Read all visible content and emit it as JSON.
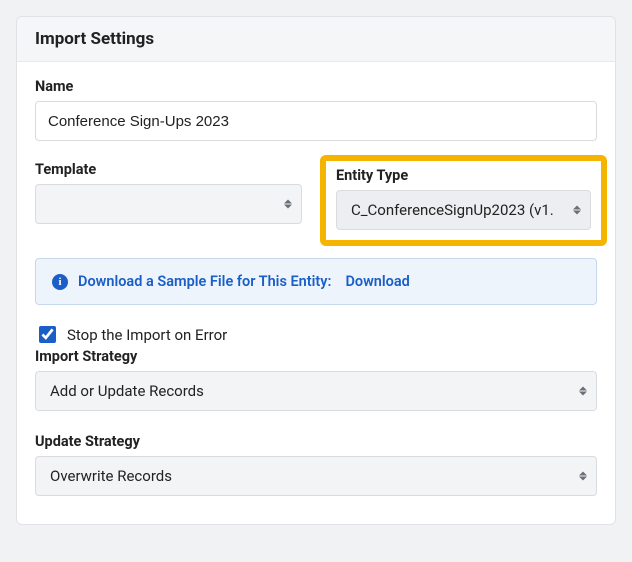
{
  "header": {
    "title": "Import Settings"
  },
  "name": {
    "label": "Name",
    "value": "Conference Sign-Ups 2023"
  },
  "template": {
    "label": "Template",
    "selected": ""
  },
  "entityType": {
    "label": "Entity Type",
    "selected": "C_ConferenceSignUp2023 (v1."
  },
  "infoBar": {
    "text": "Download a Sample File for This Entity:",
    "linkText": "Download"
  },
  "stopOnError": {
    "label": "Stop the Import on Error",
    "checked": true
  },
  "importStrategy": {
    "label": "Import Strategy",
    "selected": "Add or Update Records"
  },
  "updateStrategy": {
    "label": "Update Strategy",
    "selected": "Overwrite Records"
  }
}
